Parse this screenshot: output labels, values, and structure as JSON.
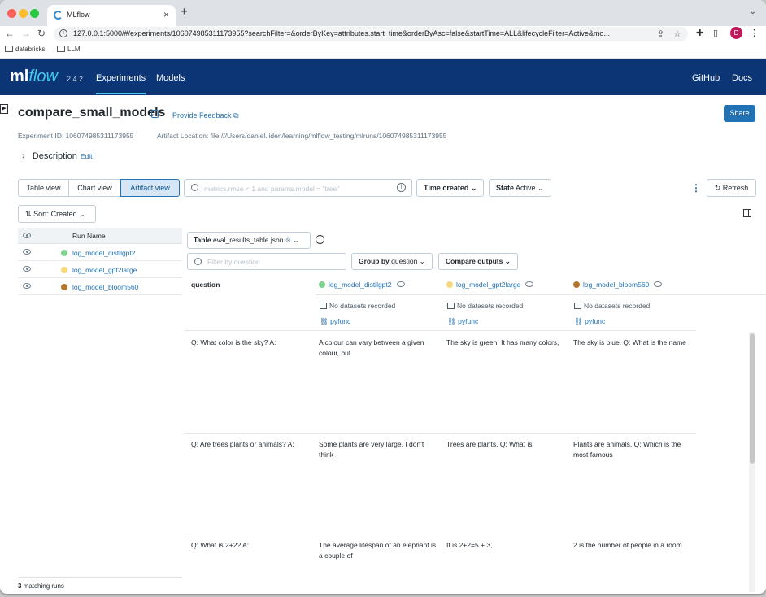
{
  "browser": {
    "tab_title": "MLflow",
    "url": "127.0.0.1:5000/#/experiments/106074985311173955?searchFilter=&orderByKey=attributes.start_time&orderByAsc=false&startTime=ALL&lifecycleFilter=Active&mo...",
    "bookmarks": [
      "databricks",
      "LLM"
    ],
    "avatar": "D"
  },
  "header": {
    "logo_ml": "ml",
    "logo_flow": "flow",
    "version": "2.4.2",
    "nav": [
      "Experiments",
      "Models"
    ],
    "right": [
      "GitHub",
      "Docs"
    ]
  },
  "experiment": {
    "title": "compare_small_models",
    "feedback": "Provide Feedback",
    "share": "Share",
    "id_text": "Experiment ID: 106074985311173955",
    "artifact_text": "Artifact Location: file:///Users/daniel.liden/learning/mlflow_testing/mlruns/106074985311173955",
    "description": "Description",
    "edit": "Edit"
  },
  "toolbar": {
    "views": [
      "Table view",
      "Chart view",
      "Artifact view"
    ],
    "search_placeholder": "metrics.rmse < 1 and params.model = \"tree\"",
    "time_created": "Time created",
    "state_label": "State",
    "state_value": "Active",
    "refresh": "Refresh",
    "sort": "Sort: Created"
  },
  "runs": {
    "column": "Run Name",
    "items": [
      {
        "name": "log_model_distilgpt2",
        "color": "#7fd38f"
      },
      {
        "name": "log_model_gpt2large",
        "color": "#f7d77c"
      },
      {
        "name": "log_model_bloom560",
        "color": "#b5762c"
      }
    ],
    "footer_count": "3",
    "footer_text": " matching runs"
  },
  "artifact": {
    "table_label": "Table",
    "table_file": "eval_results_table.json",
    "filter_placeholder": "Filter by question",
    "group_by_label": "Group by",
    "group_by_value": "question",
    "compare": "Compare outputs",
    "question_header": "question",
    "no_datasets": "No datasets recorded",
    "flavor": "pyfunc",
    "rows": [
      {
        "question": "Q: What color is the sky? A:",
        "answers": [
          "A colour can vary between a given colour, but",
          "The sky is green. It has many colors,",
          "The sky is blue. Q: What is the name"
        ]
      },
      {
        "question": "Q: Are trees plants or animals? A:",
        "answers": [
          "Some plants are very large. I don't think",
          "Trees are plants. Q: What is",
          "Plants are animals. Q: Which is the most famous"
        ]
      },
      {
        "question": "Q: What is 2+2? A:",
        "answers": [
          "The average lifespan of an elephant is a couple of",
          "It is 2+2=5 + 3,",
          "2 is the number of people in a room."
        ]
      }
    ]
  }
}
